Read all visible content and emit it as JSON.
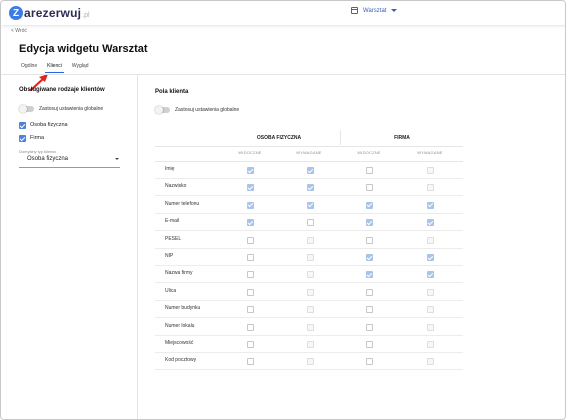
{
  "header": {
    "logo_letter": "Z",
    "logo_text": "arezerwuj",
    "logo_tld": ".pl",
    "workspace": "Warsztat"
  },
  "back_label": "< Wróć",
  "page_title": "Edycja widgetu Warsztat",
  "tabs": [
    {
      "label": "Ogólne",
      "active": false
    },
    {
      "label": "Klienci",
      "active": true
    },
    {
      "label": "Wygląd",
      "active": false
    }
  ],
  "left": {
    "title": "Obsługiwane rodzaje klientów",
    "global_toggle_label": "Zastosuj ustawienia globalne",
    "client_types": [
      {
        "label": "Osoba fizyczna",
        "checked": true
      },
      {
        "label": "Firma",
        "checked": true
      }
    ],
    "default_type_label": "Domyślny typ klienta",
    "default_type_value": "Osoba fizyczna"
  },
  "right": {
    "title": "Pola klienta",
    "global_toggle_label": "Zastosuj ustawienia globalne",
    "groups": [
      "OSOBA FIZYCZNA",
      "FIRMA"
    ],
    "subcolumns": [
      "WIDOCZNE",
      "WYMAGANE",
      "WIDOCZNE",
      "WYMAGANE"
    ],
    "rows": [
      {
        "label": "Imię",
        "cells": [
          "on",
          "on",
          "off",
          "disabled"
        ]
      },
      {
        "label": "Nazwisko",
        "cells": [
          "on",
          "on",
          "off",
          "disabled"
        ]
      },
      {
        "label": "Numer telefonu",
        "cells": [
          "on",
          "on",
          "on",
          "on"
        ]
      },
      {
        "label": "E-mail",
        "cells": [
          "on",
          "off",
          "on",
          "on"
        ]
      },
      {
        "label": "PESEL",
        "cells": [
          "off",
          "disabled",
          "off",
          "disabled"
        ]
      },
      {
        "label": "NIP",
        "cells": [
          "off",
          "disabled",
          "on",
          "on"
        ]
      },
      {
        "label": "Nazwa firmy",
        "cells": [
          "off",
          "disabled",
          "on",
          "on"
        ]
      },
      {
        "label": "Ulica",
        "cells": [
          "off",
          "disabled",
          "off",
          "disabled"
        ]
      },
      {
        "label": "Numer budynku",
        "cells": [
          "off",
          "disabled",
          "off",
          "disabled"
        ]
      },
      {
        "label": "Numer lokalu",
        "cells": [
          "off",
          "disabled",
          "off",
          "disabled"
        ]
      },
      {
        "label": "Miejscowość",
        "cells": [
          "off",
          "disabled",
          "off",
          "disabled"
        ]
      },
      {
        "label": "Kod pocztowy",
        "cells": [
          "off",
          "disabled",
          "off",
          "disabled"
        ]
      }
    ]
  },
  "colors": {
    "accent": "#2a68d8",
    "checkbox_active": "#4f83db",
    "checkbox_disabled_checked": "#a9c3ea",
    "annotation_arrow": "#e0251b"
  }
}
